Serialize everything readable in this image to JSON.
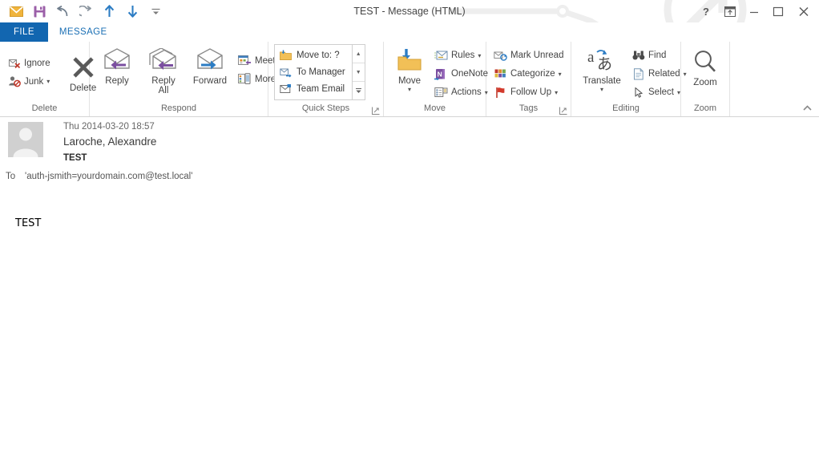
{
  "window": {
    "title": "TEST - Message (HTML)",
    "quick_access": [
      {
        "name": "send-message-icon",
        "label": "Message"
      },
      {
        "name": "save-icon",
        "label": "Save"
      },
      {
        "name": "undo-icon",
        "label": "Undo"
      },
      {
        "name": "redo-icon",
        "label": "Redo"
      },
      {
        "name": "previous-item-icon",
        "label": "Previous Item"
      },
      {
        "name": "next-item-icon",
        "label": "Next Item"
      },
      {
        "name": "customize-quick-access-toolbar-icon",
        "label": "Customize Quick Access Toolbar"
      }
    ],
    "controls": [
      {
        "name": "help-button",
        "glyph": "?"
      },
      {
        "name": "ribbon-display-options-button",
        "glyph": "⬓"
      },
      {
        "name": "minimize-button",
        "glyph": "—"
      },
      {
        "name": "maximize-button",
        "glyph": "□"
      },
      {
        "name": "close-button",
        "glyph": "✕"
      }
    ]
  },
  "tabs": [
    {
      "label": "FILE",
      "active": false
    },
    {
      "label": "MESSAGE",
      "active": true
    }
  ],
  "ribbon": {
    "collapse_label": "^",
    "groups": [
      {
        "name": "delete",
        "label": "Delete",
        "small": [
          {
            "label": "Ignore",
            "icon": "ignore-icon",
            "dropdown": false
          },
          {
            "label": "Junk",
            "icon": "junk-icon",
            "dropdown": true
          }
        ],
        "big": [
          {
            "label": "Delete",
            "icon": "delete-icon",
            "dropdown": false
          }
        ]
      },
      {
        "name": "respond",
        "label": "Respond",
        "big": [
          {
            "label": "Reply",
            "icon": "reply-icon",
            "dropdown": false
          },
          {
            "label": "Reply All",
            "icon": "reply-all-icon",
            "dropdown": false
          },
          {
            "label": "Forward",
            "icon": "forward-icon",
            "dropdown": false
          }
        ],
        "small": [
          {
            "label": "Meeting",
            "icon": "meeting-icon",
            "dropdown": false
          },
          {
            "label": "More",
            "icon": "more-respond-icon",
            "dropdown": true
          }
        ]
      },
      {
        "name": "quick-steps",
        "label": "Quick Steps",
        "has_launcher": true,
        "gallery": [
          {
            "label": "Move to: ?",
            "icon": "move-to-folder-icon"
          },
          {
            "label": "To Manager",
            "icon": "to-manager-icon"
          },
          {
            "label": "Team Email",
            "icon": "team-email-icon"
          }
        ],
        "scroll": [
          {
            "name": "quick-steps-scroll-up",
            "glyph": "▲"
          },
          {
            "name": "quick-steps-scroll-down",
            "glyph": "▼"
          },
          {
            "name": "quick-steps-more",
            "glyph": "▼"
          }
        ]
      },
      {
        "name": "move",
        "label": "Move",
        "big": [
          {
            "label": "Move",
            "icon": "move-folder-icon",
            "dropdown": true
          }
        ],
        "small": [
          {
            "label": "Rules",
            "icon": "rules-icon",
            "dropdown": true
          },
          {
            "label": "OneNote",
            "icon": "onenote-icon",
            "dropdown": false
          },
          {
            "label": "Actions",
            "icon": "actions-icon",
            "dropdown": true
          }
        ]
      },
      {
        "name": "tags",
        "label": "Tags",
        "has_launcher": true,
        "small": [
          {
            "label": "Mark Unread",
            "icon": "mark-unread-icon",
            "dropdown": false
          },
          {
            "label": "Categorize",
            "icon": "categorize-icon",
            "dropdown": true
          },
          {
            "label": "Follow Up",
            "icon": "follow-up-flag-icon",
            "dropdown": true
          }
        ]
      },
      {
        "name": "editing",
        "label": "Editing",
        "big": [
          {
            "label": "Translate",
            "icon": "translate-icon",
            "dropdown": true
          }
        ],
        "small": [
          {
            "label": "Find",
            "icon": "find-binoculars-icon",
            "dropdown": false
          },
          {
            "label": "Related",
            "icon": "related-icon",
            "dropdown": true
          },
          {
            "label": "Select",
            "icon": "select-cursor-icon",
            "dropdown": true
          }
        ]
      },
      {
        "name": "zoom",
        "label": "Zoom",
        "big": [
          {
            "label": "Zoom",
            "icon": "zoom-magnifier-icon",
            "dropdown": false
          }
        ]
      }
    ]
  },
  "message": {
    "date": "Thu 2014-03-20 18:57",
    "sender": "Laroche, Alexandre",
    "subject": "TEST",
    "to_label": "To",
    "to_value": "'auth-jsmith=yourdomain.com@test.local'",
    "body": "TEST",
    "avatar_icon": "contact-avatar-icon"
  },
  "colors": {
    "file_tab": "#1266b0",
    "active_tab_text": "#1a6fb4",
    "accent_purple": "#7b4fa0",
    "accent_blue": "#2d7dc4",
    "flag_red": "#d33a2c"
  }
}
